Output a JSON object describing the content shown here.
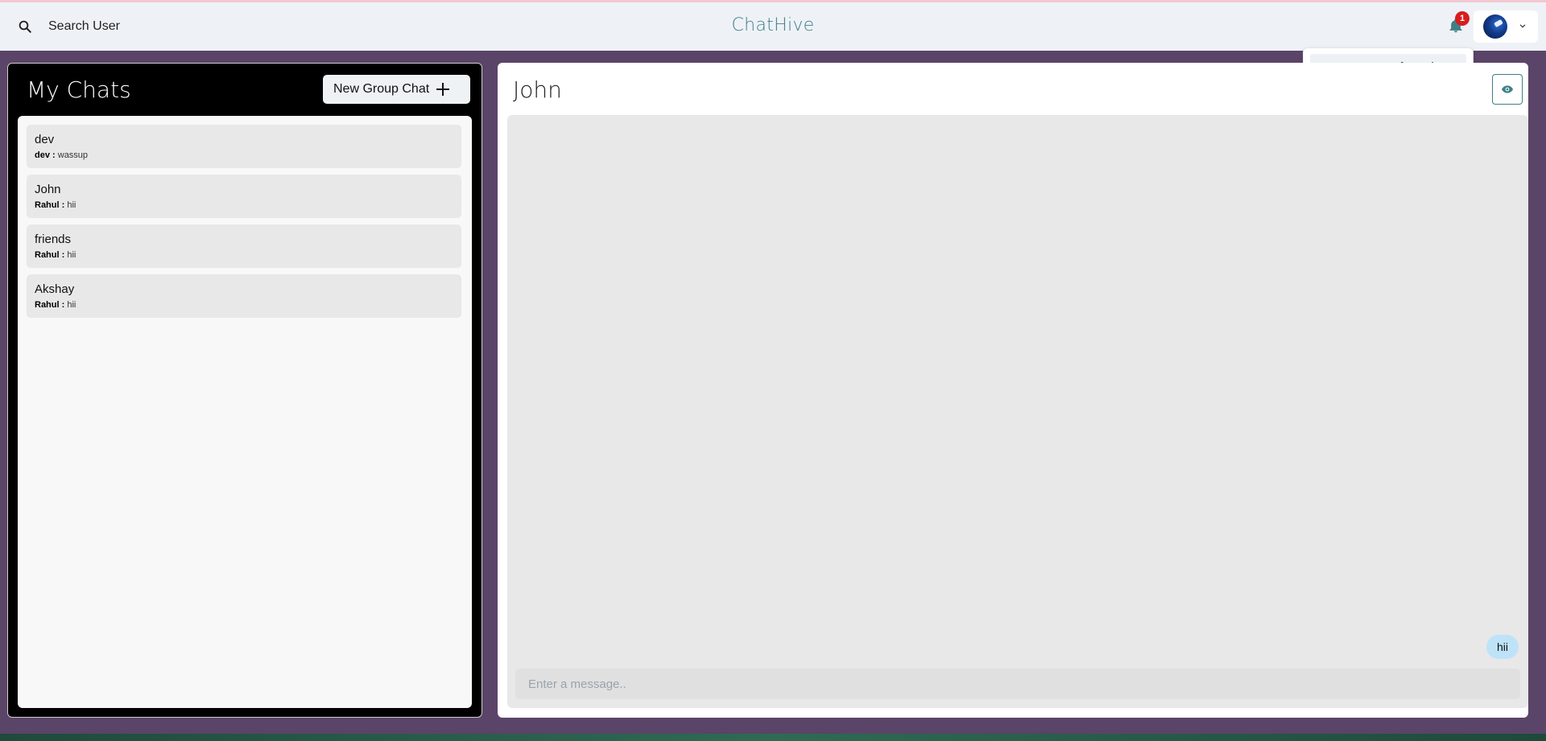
{
  "header": {
    "search_label": "Search User",
    "app_title": "ChatHive",
    "notification_count": "1",
    "notification_item": "New Message from dev"
  },
  "sidebar": {
    "title": "My Chats",
    "new_group_label": "New Group Chat",
    "chats": [
      {
        "name": "dev",
        "sender": "dev :",
        "message": "wassup"
      },
      {
        "name": "John",
        "sender": "Rahul :",
        "message": "hii"
      },
      {
        "name": "friends",
        "sender": "Rahul :",
        "message": "hii"
      },
      {
        "name": "Akshay",
        "sender": "Rahul :",
        "message": "hii"
      }
    ]
  },
  "chat": {
    "title": "John",
    "messages": [
      {
        "text": "hii",
        "own": true
      }
    ],
    "input_placeholder": "Enter a message.."
  },
  "colors": {
    "background": "#5a4468",
    "accent": "#3f7f86",
    "badge": "#d91c1c",
    "bubble": "#bee3f8"
  },
  "icons": {
    "search": "search-icon",
    "bell": "bell-icon",
    "chevron": "chevron-down-icon",
    "plus": "plus-icon",
    "eye": "eye-icon"
  }
}
